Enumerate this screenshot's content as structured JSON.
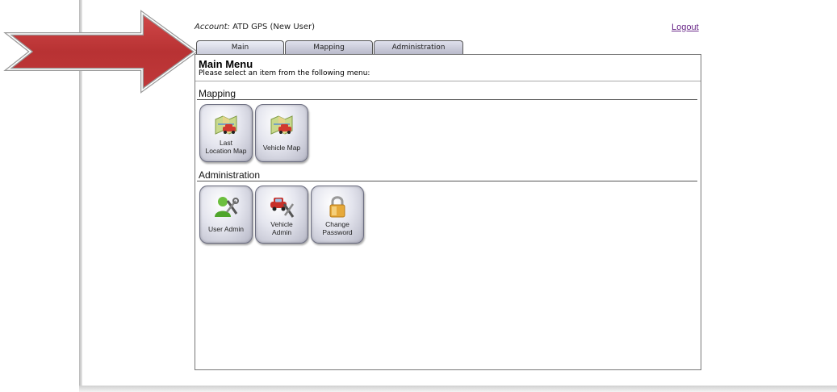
{
  "header": {
    "account_label": "Account:",
    "account_value": "ATD GPS (New User)",
    "logout": "Logout"
  },
  "tabs": [
    {
      "label": "Main"
    },
    {
      "label": "Mapping"
    },
    {
      "label": "Administration"
    }
  ],
  "main": {
    "title": "Main Menu",
    "subtitle": "Please select an item from the following menu:",
    "sections": [
      {
        "title": "Mapping",
        "items": [
          {
            "label_line1": "Last",
            "label_line2": "Location Map",
            "icon": "map-car-icon"
          },
          {
            "label_line1": "Vehicle Map",
            "label_line2": "",
            "icon": "map-car-icon"
          }
        ]
      },
      {
        "title": "Administration",
        "items": [
          {
            "label_line1": "User Admin",
            "label_line2": "",
            "icon": "user-tools-icon"
          },
          {
            "label_line1": "Vehicle",
            "label_line2": "Admin",
            "icon": "car-tools-icon"
          },
          {
            "label_line1": "Change",
            "label_line2": "Password",
            "icon": "lock-icon"
          }
        ]
      }
    ]
  },
  "colors": {
    "arrow_red": "#c0393b",
    "logout_link": "#6b2a8a",
    "tab_fill": "#c8cad9"
  }
}
